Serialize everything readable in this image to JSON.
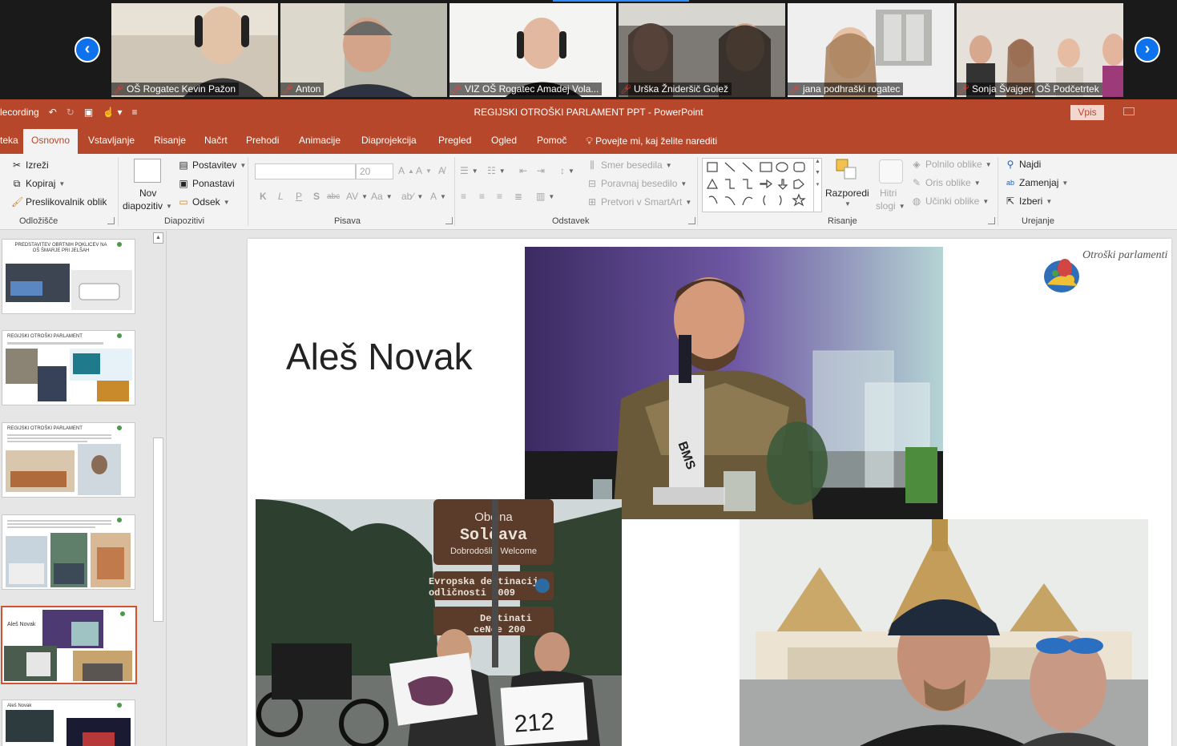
{
  "participants": [
    {
      "name": "OŠ Rogatec Kevin Pažon"
    },
    {
      "name": "Anton"
    },
    {
      "name": "VIZ OŠ Rogatec Amadej Vola..."
    },
    {
      "name": "Urška Žnideršič Golež"
    },
    {
      "name": "jana podhraški  rogatec"
    },
    {
      "name": "Sonja Švajger, OŠ Podčetrtek"
    }
  ],
  "titlebar": {
    "document_title": "REGIJSKI OTROŠKI PARLAMENT PPT  -  PowerPoint",
    "qat_label": "lecording",
    "signin_label": "Vpis"
  },
  "tabs": {
    "file": "teka",
    "home": "Osnovno",
    "insert": "Vstavljanje",
    "draw": "Risanje",
    "design": "Načrt",
    "transitions": "Prehodi",
    "animations": "Animacije",
    "slideshow": "Diaprojekcija",
    "review": "Pregled",
    "view": "Ogled",
    "help": "Pomoč",
    "tell_me": "Povejte mi, kaj želite narediti"
  },
  "ribbon": {
    "clipboard": {
      "cut": "Izreži",
      "copy": "Kopiraj",
      "painter": "Preslikovalnik oblik",
      "label": "Odložišče"
    },
    "slides": {
      "new_slide_1": "Nov",
      "new_slide_2": "diapozitiv",
      "layout": "Postavitev",
      "reset": "Ponastavi",
      "section": "Odsek",
      "label": "Diapozitivi"
    },
    "font": {
      "name_value": "",
      "size_value": "20",
      "bold": "K",
      "italic": "L",
      "underline": "P",
      "shadow": "S",
      "strike": "abc",
      "spacing": "AV",
      "case": "Aa",
      "color": "A",
      "label": "Pisava"
    },
    "paragraph": {
      "text_direction": "Smer besedila",
      "align_text": "Poravnaj besedilo",
      "smartart": "Pretvori v SmartArt",
      "label": "Odstavek"
    },
    "drawing": {
      "arrange": "Razporedi",
      "quick_styles_1": "Hitri",
      "quick_styles_2": "slogi",
      "fill": "Polnilo oblike",
      "outline": "Oris oblike",
      "effects": "Učinki oblike",
      "label": "Risanje"
    },
    "editing": {
      "find": "Najdi",
      "replace": "Zamenjaj",
      "select": "Izberi",
      "label": "Urejanje"
    }
  },
  "thumbnails": [
    {
      "text": "PREDSTAVITEV OBRTNIH POKLICEV NA OŠ ŠMARJE PRI JELŠAH"
    },
    {
      "text": "REGIJSKI OTROŠKI PARLAMENT"
    },
    {
      "text": "REGIJSKI OTROŠKI PARLAMENT"
    },
    {
      "text": ""
    },
    {
      "text": "Aleš Novak"
    },
    {
      "text": "Aleš Novak"
    }
  ],
  "slide": {
    "title": "Aleš Novak",
    "logo_text": "Otroški parlamenti",
    "sign_line1": "Občina",
    "sign_line2": "Solčava",
    "sign_line3": "Dobrodošli - Welcome",
    "sign2_line1": "Evropska destinacija",
    "sign2_line2": "odličnosti 2009",
    "sign3_line1": "Destinati",
    "sign3_line2": "ceNce 200",
    "paper_number": "212",
    "microscope_label": "BMS"
  },
  "colors": {
    "accent": "#b7472a",
    "zoom_blue": "#0e72ed",
    "selected_thumb": "#d35230"
  }
}
